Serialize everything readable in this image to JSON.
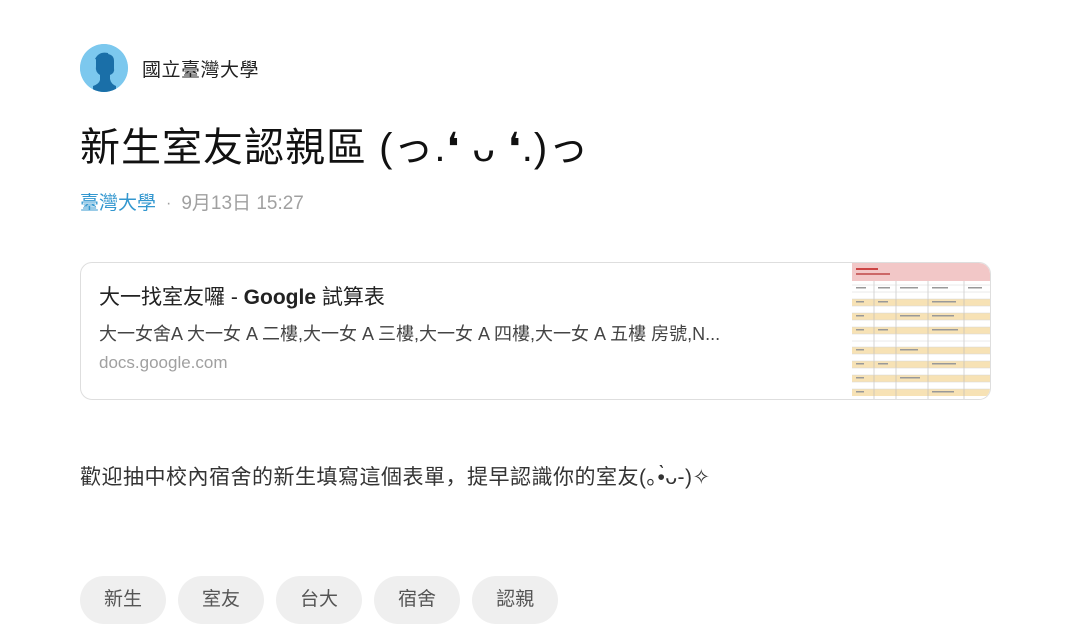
{
  "author": {
    "name": "國立臺灣大學",
    "avatar_icon": "default-user-icon",
    "avatar_color": "#7cc8ee"
  },
  "post": {
    "title": "新生室友認親區 (っ.❛ ᴗ ❛.)っ",
    "forum": "臺灣大學",
    "separator": "·",
    "timestamp": "9月13日 15:27",
    "body": "歡迎抽中校內宿舍的新生填寫這個表單，提早認識你的室友(｡•̀ᴗ-)✧"
  },
  "link_card": {
    "title_prefix": "大一找室友囉 - ",
    "title_brand": "Google",
    "title_suffix": " 試算表",
    "description": "大一女舍A 大一女 A 二樓,大一女 A 三樓,大一女 A 四樓,大一女 A 五樓 房號,N...",
    "domain": "docs.google.com",
    "thumbnail_icon": "spreadsheet-thumbnail"
  },
  "tags": [
    "新生",
    "室友",
    "台大",
    "宿舍",
    "認親"
  ],
  "colors": {
    "forum_link": "#3397cf",
    "meta_gray": "#a0a0a0",
    "tag_bg": "#efefef"
  }
}
